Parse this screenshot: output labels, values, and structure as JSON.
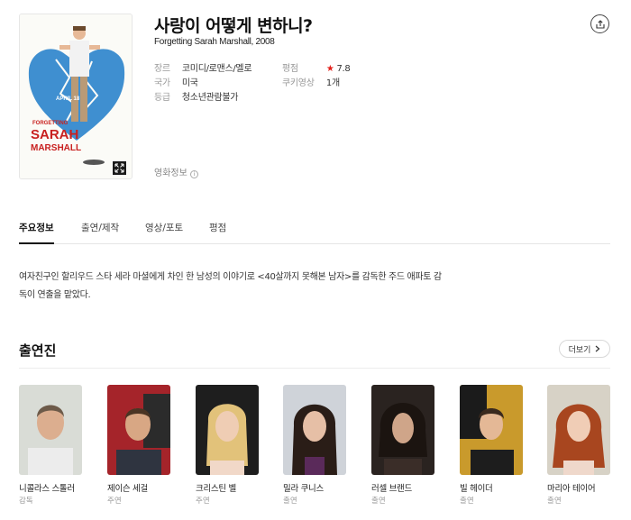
{
  "movie": {
    "title": "사랑이 어떻게 변하니?",
    "original_title_year": "Forgetting Sarah Marshall, 2008",
    "poster_text": [
      "FORGETTING",
      "SARAH",
      "MARSHALL"
    ],
    "poster_date": "APRIL 18",
    "meta": {
      "genre_label": "장르",
      "genre": "코미디/로맨스/멜로",
      "country_label": "국가",
      "country": "미국",
      "rating_label": "등급",
      "rating": "청소년관람불가",
      "score_label": "평점",
      "score": "7.8",
      "cookie_label": "쿠키영상",
      "cookie": "1개"
    },
    "info_link": "영화정보"
  },
  "tabs": [
    "주요정보",
    "출연/제작",
    "영상/포토",
    "평점"
  ],
  "synopsis": "여자친구인 할리우드 스타 세라 마셜에게 차인 한 남성의 이야기로 <40살까지 못해본 남자>를 감독한 주드 애파토 감독이 연출을 맡았다.",
  "cast_section": {
    "heading": "출연진",
    "more_label": "더보기",
    "members": [
      {
        "name": "니콜라스 스톨러",
        "role": "감독"
      },
      {
        "name": "제이슨 세걸",
        "role": "주연"
      },
      {
        "name": "크리스틴 벨",
        "role": "주연"
      },
      {
        "name": "밀라 쿠니스",
        "role": "출연"
      },
      {
        "name": "러셀 브랜드",
        "role": "출연"
      },
      {
        "name": "빌 헤이더",
        "role": "출연"
      },
      {
        "name": "마리아 테이어",
        "role": "출연"
      }
    ]
  },
  "colors": {
    "accent_star": "#e3211b",
    "poster_heart": "#3f8fd0",
    "poster_title": "#c8201f"
  }
}
